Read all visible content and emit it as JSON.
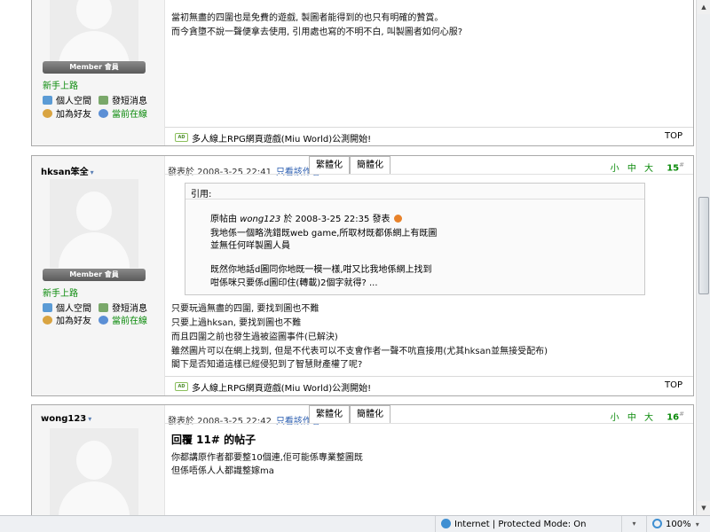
{
  "post1": {
    "member_badge": "Member 會員",
    "newbie": "新手上路",
    "sidebar_links": [
      "個人空間",
      "發短消息",
      "加為好友",
      "當前在線"
    ],
    "content_lines": [
      "當初無盡的四圍也是免費的遊戲, 製圖者能得到的也只有明確的贊賞。",
      "而今貪墮不說一聲便拿去使用, 引用處也寫的不明不白, 叫製圖者如何心服?"
    ],
    "ad_text": "多人線上RPG網頁遊戲(Miu World)公測開始!",
    "top_label": "TOP"
  },
  "post2": {
    "author": "hksan笨全",
    "posted": "發表於 2008-3-25 22:41",
    "only_author": "只看該作者",
    "tab_traditional": "繁體化",
    "tab_simplified": "簡體化",
    "size_controls": "小 中 大",
    "floor": "15",
    "floor_sup": "#",
    "member_badge": "Member 會員",
    "newbie": "新手上路",
    "sidebar_links": [
      "個人空間",
      "發短消息",
      "加為好友",
      "當前在線"
    ],
    "quote": {
      "title": "引用:",
      "origin_prefix": "原帖由",
      "origin_user": "wong123",
      "origin_suffix": "於 2008-3-25 22:35 發表",
      "lines": [
        "我地係一個略洗錯既web game,所取材既都係網上有既圖",
        "並無任何咩製圖人員",
        "",
        "既然你地話d圖同你地既一模一樣,咁又比我地係網上找到",
        "咁係咪只要係d圖印住(轉載)2個字就得? ..."
      ]
    },
    "content_lines": [
      "只要玩過無盡的四圍, 要找到圖也不難",
      "只要上過hksan, 要找到圖也不難",
      "而且四圍之前也發生過被盜圖事件(已解決)",
      "雖然圖片可以在網上找到, 但是不代表可以不支會作者一聲不吭直接用(尤其hksan並無接受配布)",
      "閣下是否知道這樣已經侵犯到了智慧財產權了呢?"
    ],
    "ad_text": "多人線上RPG網頁遊戲(Miu World)公測開始!",
    "top_label": "TOP"
  },
  "post3": {
    "author": "wong123",
    "posted": "發表於 2008-3-25 22:42",
    "only_author": "只看該作者",
    "tab_traditional": "繁體化",
    "tab_simplified": "簡體化",
    "size_controls": "小 中 大",
    "floor": "16",
    "floor_sup": "#",
    "reply_title": "回覆 11# 的帖子",
    "content_lines": [
      "你都講原作者都要整10個連,佢可能係專業整圖既",
      "但係唔係人人都識整嫁ma"
    ]
  },
  "statusbar": {
    "zone": "Internet | Protected Mode: On",
    "zoom": "100%"
  }
}
